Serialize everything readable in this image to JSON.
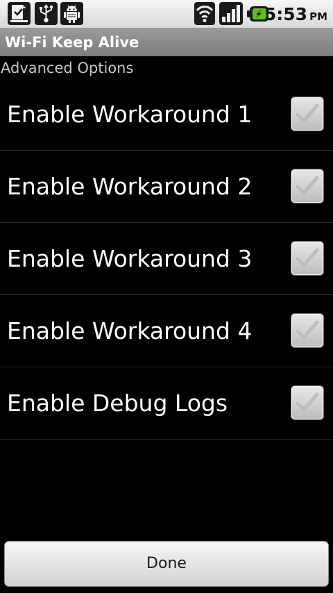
{
  "status_bar": {
    "icons": [
      "download-icon",
      "usb-icon",
      "android-debug-icon",
      "wifi-icon",
      "signal-icon",
      "battery-charging-icon"
    ],
    "time": "5:53",
    "ampm": "PM"
  },
  "app": {
    "title": "Wi-Fi Keep Alive"
  },
  "category": {
    "label": "Advanced Options"
  },
  "preferences": [
    {
      "label": "Enable Workaround 1",
      "checked": false
    },
    {
      "label": "Enable Workaround 2",
      "checked": false
    },
    {
      "label": "Enable Workaround 3",
      "checked": false
    },
    {
      "label": "Enable Workaround 4",
      "checked": false
    },
    {
      "label": "Enable Debug Logs",
      "checked": false
    }
  ],
  "done_button": {
    "label": "Done"
  },
  "colors": {
    "background": "#000000",
    "title_bar": "#8a8a8a",
    "category_text": "#c8c8c8",
    "check_mark": "#bcbcbc"
  }
}
